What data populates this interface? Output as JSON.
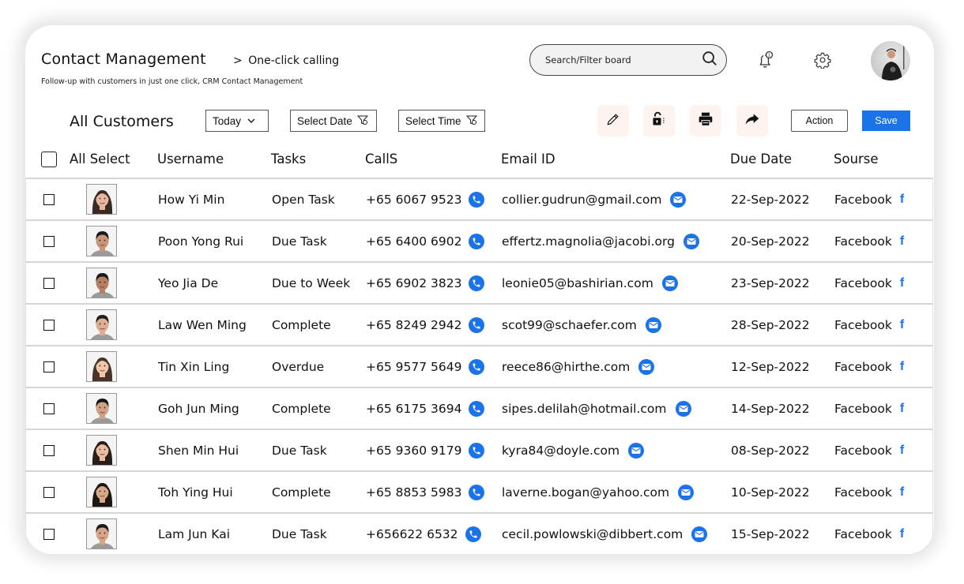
{
  "header": {
    "title": "Contact Management",
    "breadcrumb": "One-click calling",
    "breadcrumb_separator": ">",
    "subtitle": "Follow-up with customers in just one click, CRM Contact Management",
    "search_placeholder": "Search/Filter board",
    "notification_count": "1"
  },
  "toolbar": {
    "section_title": "All Customers",
    "filter_today": "Today",
    "filter_date": "Select Date",
    "filter_time": "Select Time",
    "action_label": "Action",
    "save_label": "Save"
  },
  "colors": {
    "accent": "#1a73e8",
    "tool_bg": "#fdf4ef"
  },
  "table": {
    "columns": [
      "All Select",
      "Username",
      "Tasks",
      "CallS",
      "Email ID",
      "Due Date",
      "Sourse"
    ],
    "rows": [
      {
        "username": "How Yi Min",
        "task": "Open Task",
        "call": "+65 6067 9523",
        "email": "collier.gudrun@gmail.com",
        "due": "22-Sep-2022",
        "source": "Facebook",
        "avatar": "female-1"
      },
      {
        "username": "Poon Yong Rui",
        "task": "Due Task",
        "call": "+65 6400 6902",
        "email": "effertz.magnolia@jacobi.org",
        "due": "20-Sep-2022",
        "source": "Facebook",
        "avatar": "male-1"
      },
      {
        "username": "Yeo Jia De",
        "task": "Due to Week",
        "call": "+65 6902 3823",
        "email": "leonie05@bashirian.com",
        "due": "23-Sep-2022",
        "source": "Facebook",
        "avatar": "male-2"
      },
      {
        "username": "Law Wen Ming",
        "task": "Complete",
        "call": "+65 8249 2942",
        "email": "scot99@schaefer.com",
        "due": "28-Sep-2022",
        "source": "Facebook",
        "avatar": "male-3"
      },
      {
        "username": "Tin Xin Ling",
        "task": "Overdue",
        "call": "+65 9577 5649",
        "email": "reece86@hirthe.com",
        "due": "12-Sep-2022",
        "source": "Facebook",
        "avatar": "female-2"
      },
      {
        "username": "Goh Jun Ming",
        "task": "Complete",
        "call": "+65 6175 3694",
        "email": "sipes.delilah@hotmail.com",
        "due": "14-Sep-2022",
        "source": "Facebook",
        "avatar": "male-4"
      },
      {
        "username": "Shen Min Hui",
        "task": "Due Task",
        "call": "+65 9360 9179",
        "email": "kyra84@doyle.com",
        "due": "08-Sep-2022",
        "source": "Facebook",
        "avatar": "female-3"
      },
      {
        "username": "Toh Ying Hui",
        "task": "Complete",
        "call": "+65 8853 5983",
        "email": "laverne.bogan@yahoo.com",
        "due": "10-Sep-2022",
        "source": "Facebook",
        "avatar": "female-4"
      },
      {
        "username": "Lam Jun Kai",
        "task": "Due Task",
        "call": "+656622 6532",
        "email": "cecil.powlowski@dibbert.com",
        "due": "15-Sep-2022",
        "source": "Facebook",
        "avatar": "male-5"
      }
    ]
  }
}
